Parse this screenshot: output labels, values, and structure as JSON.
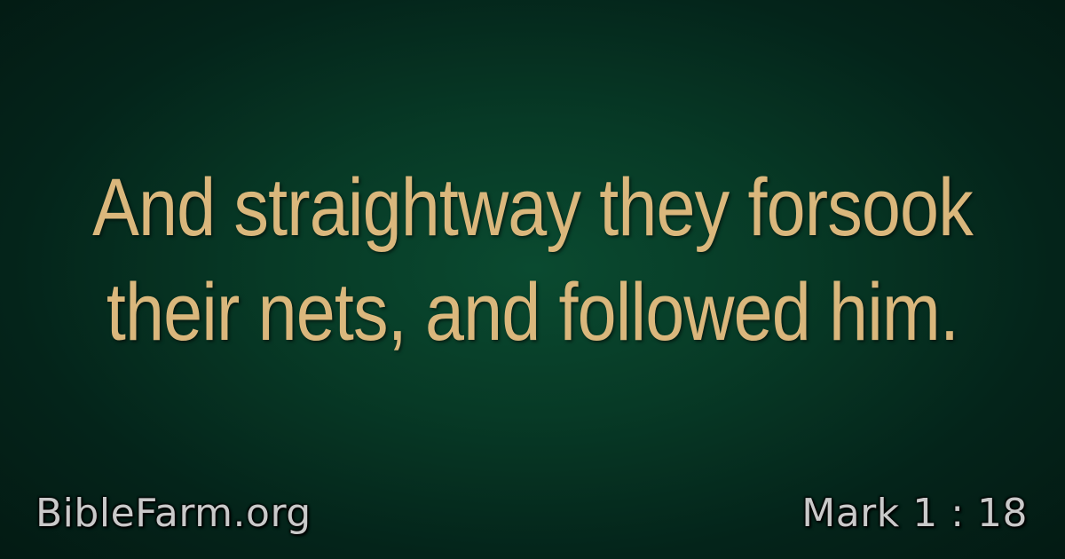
{
  "verse": {
    "lines": [
      "And straightway they forsook",
      "their nets, and followed him."
    ]
  },
  "footer": {
    "site": "BibleFarm.org",
    "reference": "Mark 1 : 18"
  },
  "colors": {
    "verse_text": "#dab77c",
    "footer_text": "#c9c9c9",
    "background_center": "#0a4a30",
    "background_edge": "#031a13"
  }
}
